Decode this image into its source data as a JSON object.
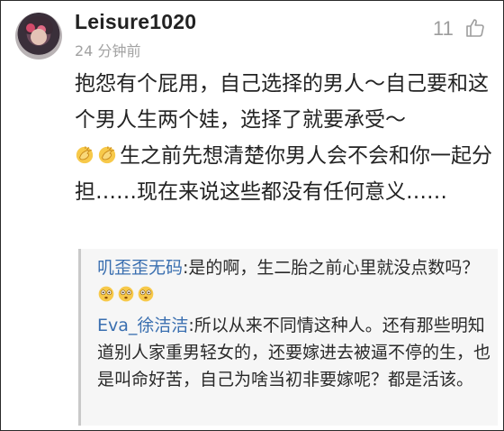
{
  "comment": {
    "username": "Leisure1020",
    "timestamp": "24 分钟前",
    "like_count": "11",
    "text_part1": "抱怨有个屁用，自己选择的男人～自己要和这个男人生两个娃，选择了就要承受～",
    "text_part2": "生之前先想清楚你男人会不会和你一起分担……现在来说这些都没有任何意义……"
  },
  "replies": [
    {
      "name": "叽歪歪无码",
      "text": ":是的啊，生二胎之前心里就没点数吗？"
    },
    {
      "name": "Eva_徐洁洁",
      "text": ":所以从来不同情这种人。还有那些明知道别人家重男轻女的，还要嫁进去被逼不停的生，也是叫命好苦，自己为啥当初非要嫁呢？都是活该。"
    }
  ],
  "icons": {
    "like": "thumbs-up-icon",
    "applause_emoji": "applause-emoji-icon",
    "flushed_emoji": "flushed-face-emoji-icon"
  },
  "colors": {
    "reply_name": "#3a6fb0",
    "meta_gray": "#a2a2a2",
    "reply_bg": "#f6f6f6"
  }
}
